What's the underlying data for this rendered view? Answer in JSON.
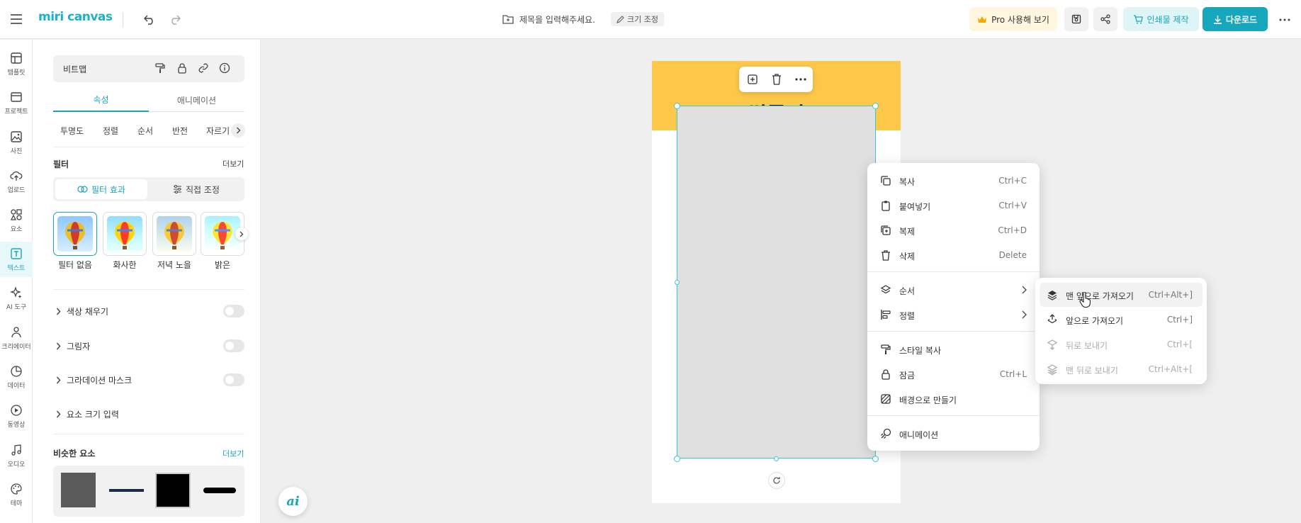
{
  "topbar": {
    "logo": "miri canvas",
    "title": "제목을 입력해주세요.",
    "resize_label": "크기 조정",
    "pro_label": "Pro 사용해 보기",
    "print_label": "인쇄물 제작",
    "download_label": "다운로드"
  },
  "leftnav": {
    "items": [
      {
        "label": "템플릿",
        "icon": "template-icon"
      },
      {
        "label": "프로젝트",
        "icon": "project-icon"
      },
      {
        "label": "사진",
        "icon": "photo-icon"
      },
      {
        "label": "업로드",
        "icon": "upload-icon"
      },
      {
        "label": "요소",
        "icon": "elements-icon"
      },
      {
        "label": "텍스트",
        "icon": "text-icon"
      },
      {
        "label": "AI 도구",
        "icon": "ai-tools-icon"
      },
      {
        "label": "크리에이터",
        "icon": "creator-icon"
      },
      {
        "label": "데이터",
        "icon": "data-icon"
      },
      {
        "label": "동영상",
        "icon": "video-icon"
      },
      {
        "label": "오디오",
        "icon": "audio-icon"
      },
      {
        "label": "테마",
        "icon": "theme-icon"
      }
    ]
  },
  "panel": {
    "object_name": "비트맵",
    "tabs": [
      "속성",
      "애니메이션"
    ],
    "subtabs": [
      "투명도",
      "정렬",
      "순서",
      "반전",
      "자르기"
    ],
    "filter": {
      "title": "필터",
      "more": "더보기",
      "modes": [
        "필터 효과",
        "직접 조정"
      ],
      "presets": [
        "필터 없음",
        "화사한",
        "저녁 노을",
        "밝은"
      ]
    },
    "accordions": [
      "색상 채우기",
      "그림자",
      "그라데이션 마스크",
      "요소 크기 입력"
    ],
    "similar": {
      "title": "비슷한 요소",
      "more": "더보기"
    }
  },
  "canvas": {
    "headline": "썰통닭"
  },
  "context_menu": {
    "items": [
      {
        "label": "복사",
        "shortcut": "Ctrl+C",
        "icon": "copy-icon"
      },
      {
        "label": "붙여넣기",
        "shortcut": "Ctrl+V",
        "icon": "paste-icon"
      },
      {
        "label": "복제",
        "shortcut": "Ctrl+D",
        "icon": "duplicate-icon"
      },
      {
        "label": "삭제",
        "shortcut": "Delete",
        "icon": "trash-icon"
      },
      {
        "label": "순서",
        "shortcut": "",
        "icon": "layers-icon"
      },
      {
        "label": "정렬",
        "shortcut": "",
        "icon": "align-icon"
      },
      {
        "label": "스타일 복사",
        "shortcut": "",
        "icon": "paint-roller-icon"
      },
      {
        "label": "잠금",
        "shortcut": "Ctrl+L",
        "icon": "lock-icon"
      },
      {
        "label": "배경으로 만들기",
        "shortcut": "",
        "icon": "background-icon"
      },
      {
        "label": "애니메이션",
        "shortcut": "",
        "icon": "animation-icon"
      }
    ]
  },
  "order_submenu": {
    "items": [
      {
        "label": "맨 앞으로 가져오기",
        "shortcut": "Ctrl+Alt+]",
        "enabled": true
      },
      {
        "label": "앞으로 가져오기",
        "shortcut": "Ctrl+]",
        "enabled": true
      },
      {
        "label": "뒤로 보내기",
        "shortcut": "Ctrl+[",
        "enabled": false
      },
      {
        "label": "맨 뒤로 보내기",
        "shortcut": "Ctrl+Alt+[",
        "enabled": false
      }
    ]
  },
  "ai_button": "ai",
  "colors": {
    "accent": "#16a7bd",
    "banner": "#fdc84a",
    "pro_bg": "#fff6e0"
  }
}
